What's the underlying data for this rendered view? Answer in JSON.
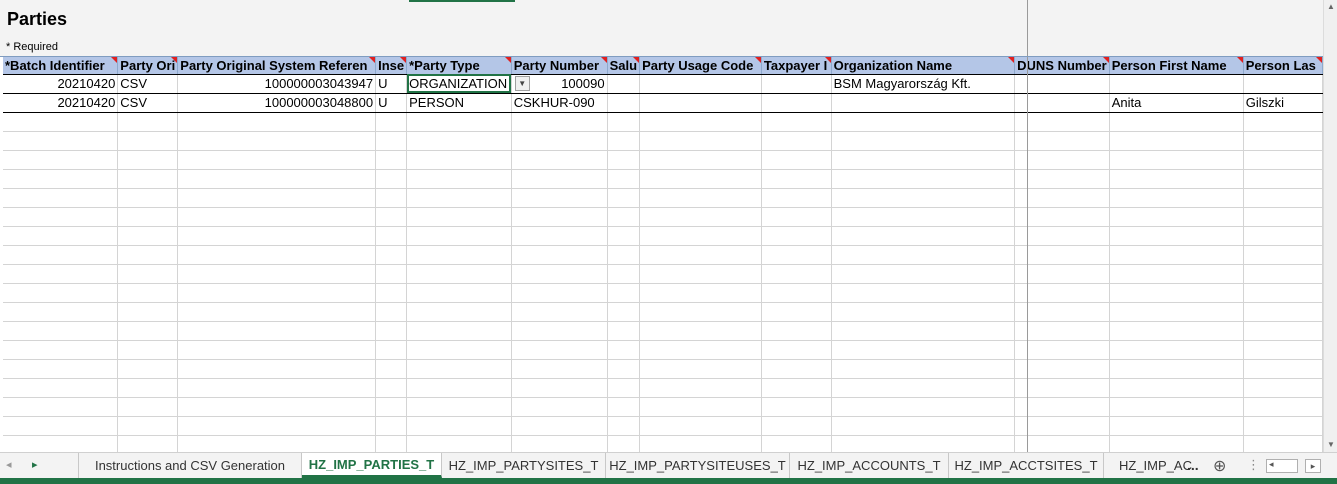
{
  "sheet": {
    "title": "Parties",
    "required_note": "* Required",
    "columns": [
      "*Batch Identifier",
      "Party Ori",
      "Party Original System Referen",
      "Inse",
      "*Party Type",
      "Party Number",
      "Salu",
      "Party Usage Code",
      "Taxpayer I",
      "Organization Name",
      "DUNS Number",
      "Person First Name",
      "Person Las"
    ],
    "rows": [
      [
        "20210420",
        "CSV",
        "100000003043947",
        "U",
        "ORGANIZATION",
        "100090",
        "",
        "",
        "",
        "BSM Magyarország Kft.",
        "",
        "",
        ""
      ],
      [
        "20210420",
        "CSV",
        "100000003048800",
        "U",
        "PERSON",
        "CSKHUR-090",
        "",
        "",
        "",
        "",
        "",
        "Anita",
        "Gilszki"
      ]
    ],
    "dropdown_icon": "chevron-down-icon"
  },
  "tabs": {
    "items": [
      "Instructions and CSV Generation",
      "HZ_IMP_PARTIES_T",
      "HZ_IMP_PARTYSITES_T",
      "HZ_IMP_PARTYSITEUSES_T",
      "HZ_IMP_ACCOUNTS_T",
      "HZ_IMP_ACCTSITES_T",
      "HZ_IMP_AC"
    ],
    "active": "HZ_IMP_PARTIES_T",
    "overflow": "...",
    "add": "⊕",
    "options": "⋮"
  },
  "colors": {
    "accent": "#217346",
    "header_fill": "#b4c6e7",
    "required_flag": "#e02020"
  }
}
